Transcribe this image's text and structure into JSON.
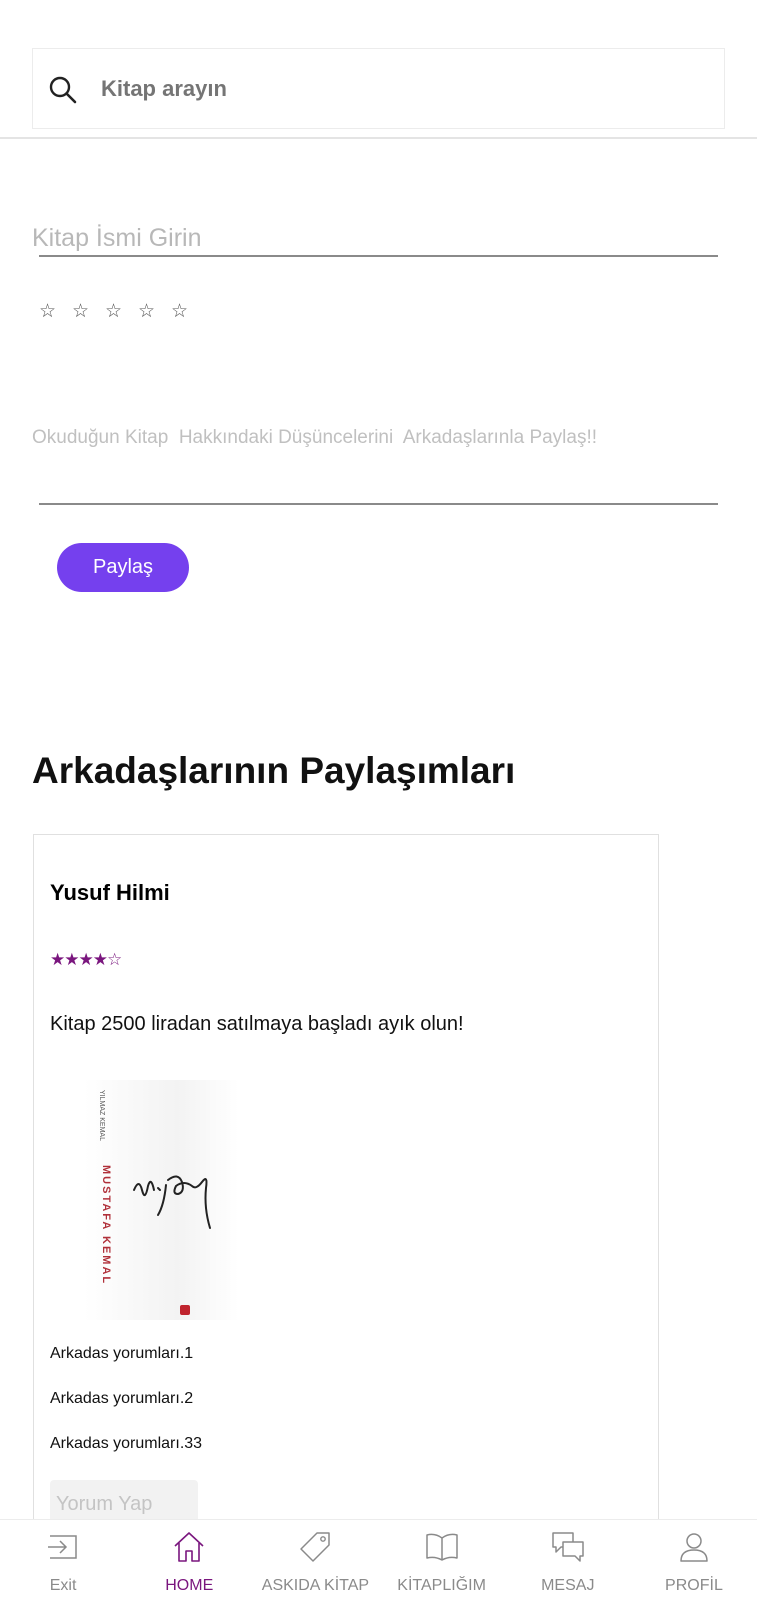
{
  "search": {
    "placeholder": "Kitap arayın"
  },
  "compose": {
    "book_name_placeholder": "Kitap İsmi Girin",
    "rating_stars": 0,
    "thoughts_placeholder": "Okuduğun Kitap  Hakkındaki Düşüncelerini  Arkadaşlarınla Paylaş!!",
    "share_label": "Paylaş"
  },
  "feed": {
    "title": "Arkadaşlarının Paylaşımları",
    "posts": [
      {
        "author": "Yusuf Hilmi",
        "rating": 4.5,
        "text": "Kitap 2500 liradan satılmaya başladı ayık olun!",
        "cover": {
          "spine_title": "MUSTAFA KEMAL",
          "spine_small": "YILMAZ KEMAL",
          "signature": "M. Kemal"
        },
        "comments": [
          "Arkadas yorumları.1",
          "Arkadas yorumları.2",
          "Arkadas yorumları.33"
        ],
        "comment_placeholder": "Yorum Yap"
      }
    ]
  },
  "nav": {
    "active": "home",
    "items": [
      {
        "id": "exit",
        "label": "Exit",
        "icon": "exit-icon"
      },
      {
        "id": "home",
        "label": "HOME",
        "icon": "home-icon"
      },
      {
        "id": "askida",
        "label": "ASKIDA KİTAP",
        "icon": "tag-icon"
      },
      {
        "id": "library",
        "label": "KİTAPLIĞIM",
        "icon": "book-icon"
      },
      {
        "id": "message",
        "label": "MESAJ",
        "icon": "chat-icon"
      },
      {
        "id": "profile",
        "label": "PROFİL",
        "icon": "user-icon"
      }
    ]
  },
  "colors": {
    "accent": "#7540ee",
    "active_nav": "#7a167e",
    "stars": "#7a167e"
  }
}
